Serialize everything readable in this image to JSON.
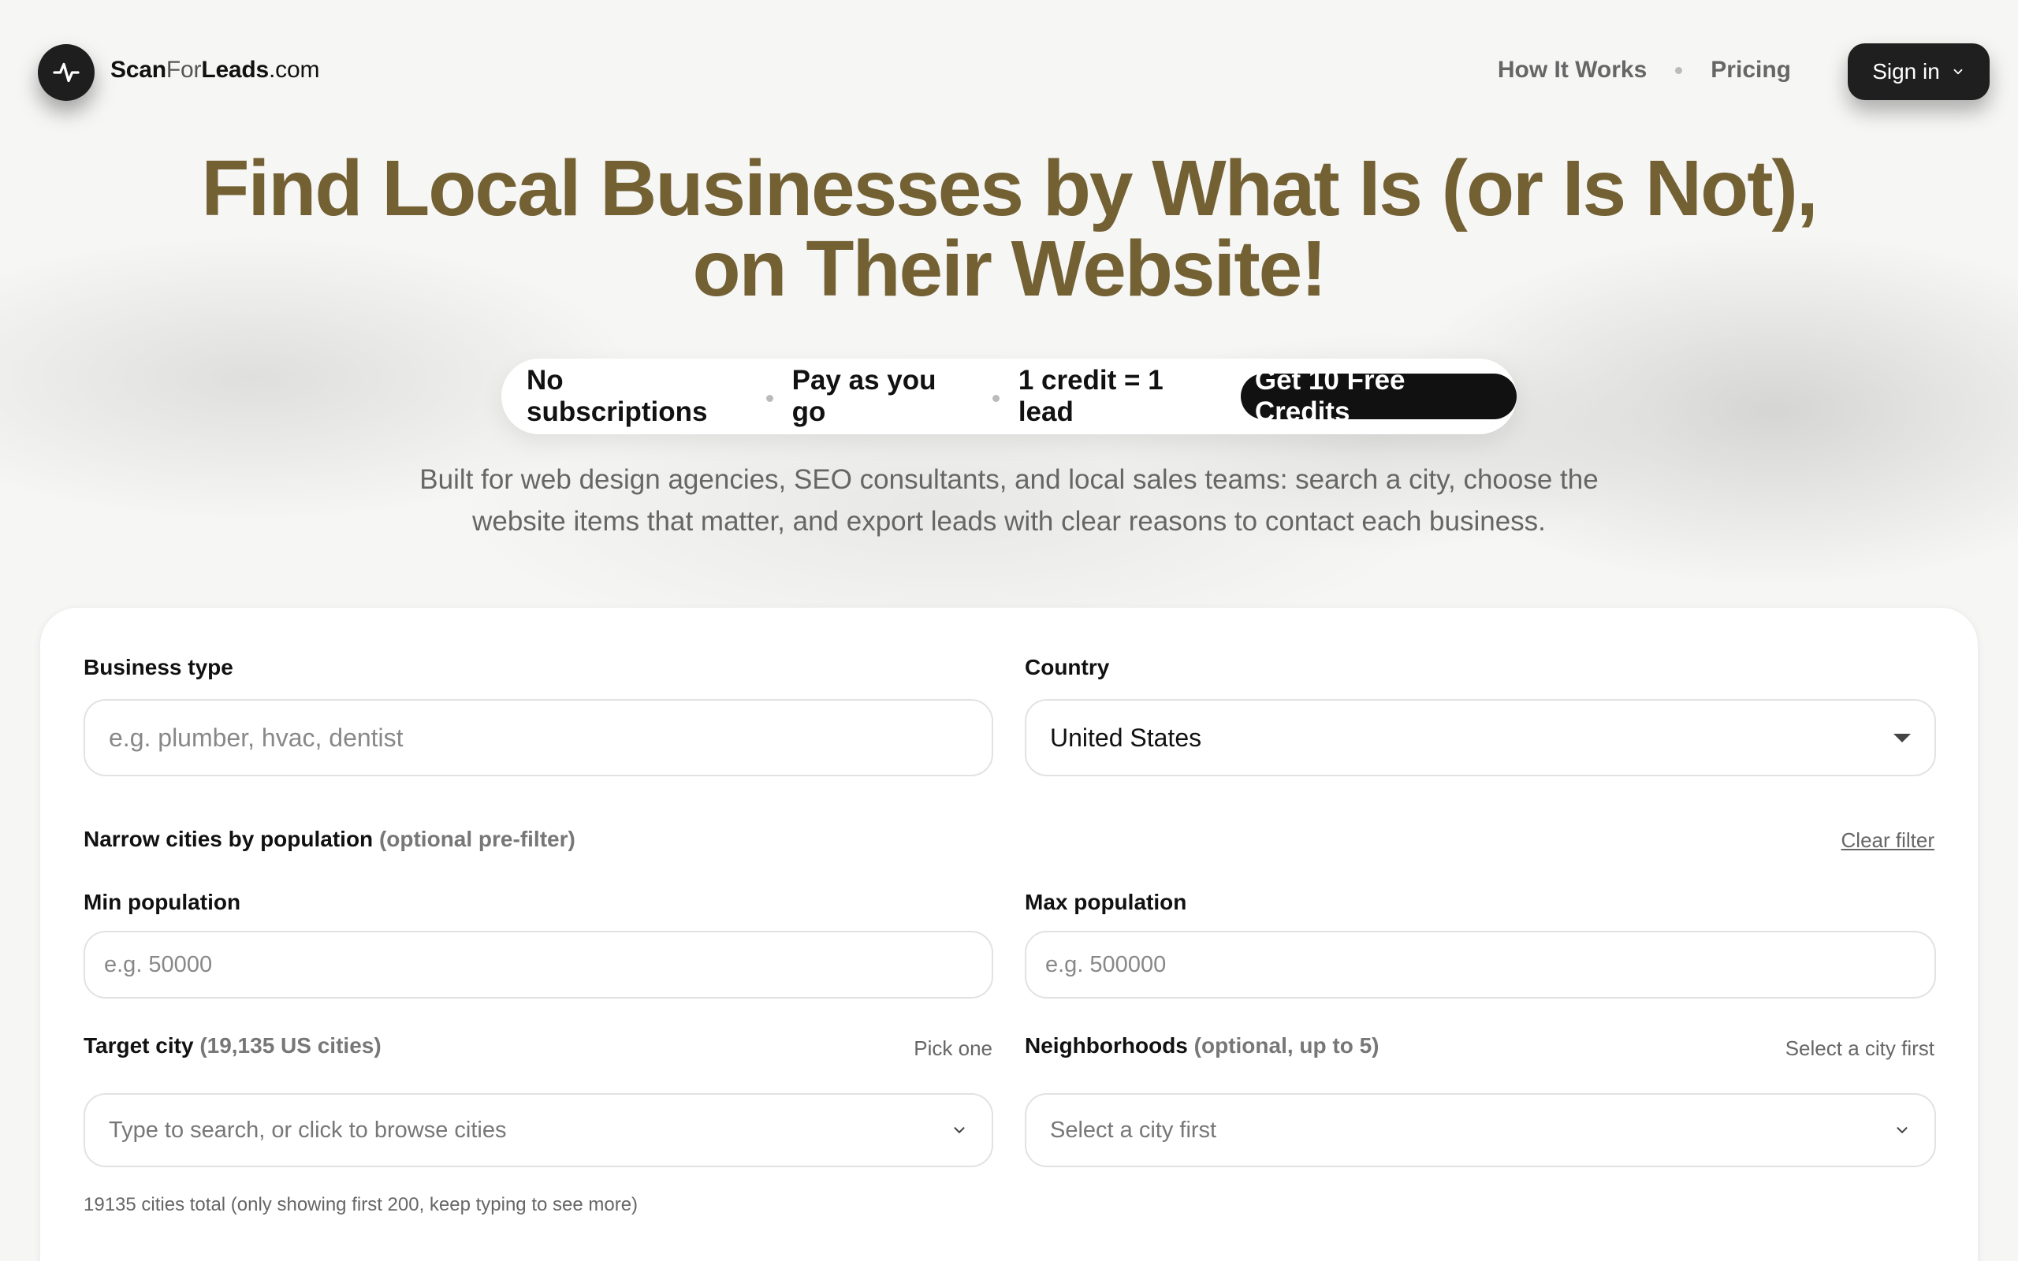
{
  "header": {
    "logo_part1": "Scan",
    "logo_part2": "For",
    "logo_part3": "Leads",
    "logo_part4": ".com",
    "logo_icon": "pulse-icon",
    "nav": [
      "How It Works",
      "Pricing"
    ],
    "signin_label": "Sign in"
  },
  "hero": {
    "title_line1": "Find Local Businesses by What Is (or Is Not),",
    "title_line2": "on Their Website!",
    "pill_items": [
      "No subscriptions",
      "Pay as you go",
      "1 credit = 1 lead"
    ],
    "pill_cta": "Get 10 Free Credits",
    "subtitle_line1": "Built for web design agencies, SEO consultants, and local sales teams: search a city, choose the",
    "subtitle_line2": "website items that matter, and export leads with clear reasons to contact each business."
  },
  "form": {
    "business_type_label": "Business type",
    "business_type_placeholder": "e.g. plumber, hvac, dentist",
    "country_label": "Country",
    "country_value": "United States",
    "narrow_label": "Narrow cities by population",
    "narrow_hint": "(optional pre-filter)",
    "clear_filter": "Clear filter",
    "min_pop_label": "Min population",
    "min_pop_placeholder": "e.g. 50000",
    "max_pop_label": "Max population",
    "max_pop_placeholder": "e.g. 500000",
    "target_city_label": "Target city",
    "target_city_hint": "(19,135 US cities)",
    "target_city_right": "Pick one",
    "target_city_placeholder": "Type to search, or click to browse cities",
    "neighborhoods_label": "Neighborhoods",
    "neighborhoods_hint": "(optional, up to 5)",
    "neighborhoods_right": "Select a city first",
    "neighborhoods_placeholder": "Select a city first",
    "cities_footnote": "19135 cities total (only showing first 200, keep typing to see more)"
  }
}
